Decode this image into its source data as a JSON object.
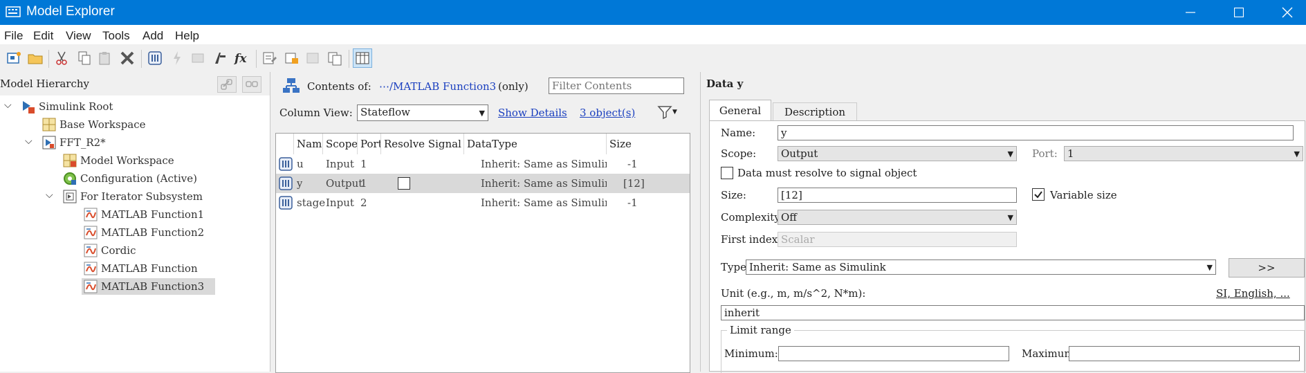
{
  "window": {
    "title": "Model Explorer"
  },
  "menu": [
    "File",
    "Edit",
    "View",
    "Tools",
    "Add",
    "Help"
  ],
  "hierarchy": {
    "header": "Model Hierarchy",
    "items": [
      {
        "label": "Simulink Root",
        "level": 0,
        "expanded": true,
        "icon": "simulink-root-icon"
      },
      {
        "label": "Base Workspace",
        "level": 1,
        "icon": "workspace-icon"
      },
      {
        "label": "FFT_R2*",
        "level": 1,
        "expanded": true,
        "icon": "model-icon"
      },
      {
        "label": "Model Workspace",
        "level": 2,
        "icon": "model-workspace-icon"
      },
      {
        "label": "Configuration (Active)",
        "level": 2,
        "icon": "configuration-icon"
      },
      {
        "label": "For Iterator Subsystem",
        "level": 2,
        "expanded": true,
        "icon": "subsystem-icon"
      },
      {
        "label": "MATLAB Function1",
        "level": 3,
        "icon": "matlab-function-icon"
      },
      {
        "label": "MATLAB Function2",
        "level": 3,
        "icon": "matlab-function-icon"
      },
      {
        "label": "Cordic",
        "level": 3,
        "icon": "matlab-function-icon"
      },
      {
        "label": "MATLAB Function",
        "level": 3,
        "icon": "matlab-function-icon"
      },
      {
        "label": "MATLAB Function3",
        "level": 3,
        "icon": "matlab-function-icon",
        "selected": true
      }
    ]
  },
  "contents": {
    "label": "Contents of:",
    "path": "⋯/MATLAB Function3",
    "scope": "(only)",
    "filter_placeholder": "Filter Contents",
    "column_view_label": "Column View:",
    "column_view_value": "Stateflow",
    "show_details": "Show Details",
    "object_count": "3 object(s)",
    "columns": [
      "Name",
      "Scope",
      "Port",
      "Resolve Signal",
      "DataType",
      "Size"
    ],
    "rows": [
      {
        "name": "u",
        "scope": "Input",
        "port": "1",
        "resolve": "",
        "datatype": "Inherit: Same as Simulink",
        "size": "-1"
      },
      {
        "name": "y",
        "scope": "Output",
        "port": "1",
        "resolve": "checkbox",
        "datatype": "Inherit: Same as Simulink",
        "size": "[12]",
        "selected": true
      },
      {
        "name": "stage",
        "scope": "Input",
        "port": "2",
        "resolve": "",
        "datatype": "Inherit: Same as Simulink",
        "size": "-1"
      }
    ]
  },
  "details": {
    "title": "Data y",
    "tabs": [
      "General",
      "Description"
    ],
    "name_label": "Name:",
    "name_value": "y",
    "scope_label": "Scope:",
    "scope_value": "Output",
    "port_label": "Port:",
    "port_value": "1",
    "resolve_label": "Data must resolve to signal object",
    "size_label": "Size:",
    "size_value": "[12]",
    "variable_size_label": "Variable size",
    "complexity_label": "Complexity:",
    "complexity_value": "Off",
    "first_index_label": "First index",
    "first_index_placeholder": "Scalar",
    "type_label": "Type:",
    "type_value": "Inherit: Same as Simulink",
    "type_button": ">>",
    "unit_label": "Unit (e.g., m, m/s^2, N*m):",
    "unit_link": "SI, English, ...",
    "unit_value": "inherit",
    "limit_range_label": "Limit range",
    "minimum_label": "Minimum:",
    "maximum_label": "Maximum:"
  }
}
